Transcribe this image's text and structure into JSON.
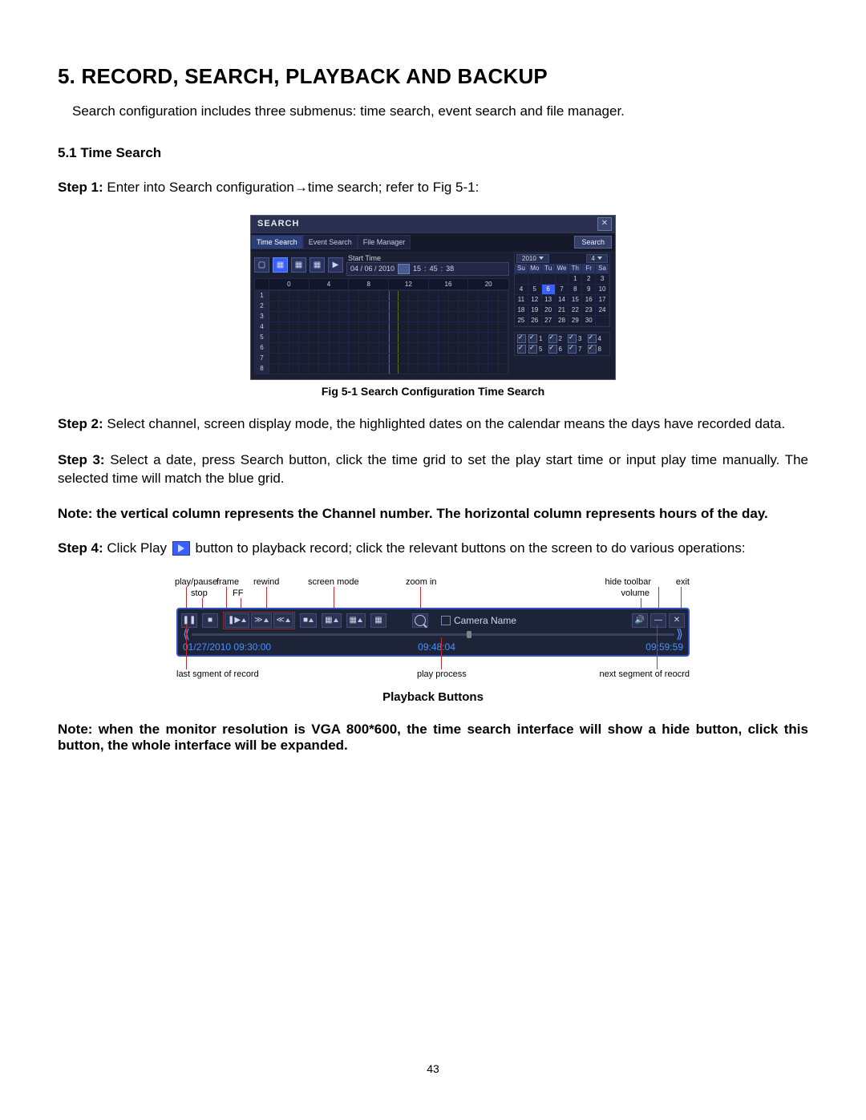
{
  "page_number": "43",
  "chapter_title": "5. RECORD, SEARCH, PLAYBACK AND BACKUP",
  "intro": "Search configuration includes three submenus: time search, event search and file manager.",
  "section_5_1": "5.1 Time Search",
  "step1_prefix": "Step 1: ",
  "step1": "Enter into Search configuration→time search; refer to Fig 5-1:",
  "fig5_1_caption": "Fig 5-1 Search Configuration Time Search",
  "step2_prefix": "Step 2: ",
  "step2": "Select channel, screen display mode, the highlighted dates on the calendar means the days have recorded data.",
  "step3_prefix": "Step 3: ",
  "step3": "Select a date, press Search button, click the time grid to set the play start time or input play time manually. The selected time will match the blue grid.",
  "note1": "Note: the vertical column represents the Channel number. The horizontal column represents hours of the day.",
  "step4_prefix": "Step 4: ",
  "step4_a": "Click Play ",
  "step4_b": " button to playback record; click the relevant buttons on the screen to do various operations:",
  "fig_pb_caption": "Playback Buttons",
  "note2": "Note: when the monitor resolution is VGA 800*600, the time search interface will show a hide button, click this button, the whole interface will be expanded.",
  "search_window": {
    "title": "SEARCH",
    "tabs": [
      "Time Search",
      "Event Search",
      "File Manager"
    ],
    "search_btn": "Search",
    "start_time_label": "Start Time",
    "date_value": "04 / 06 / 2010",
    "time_h": "15",
    "time_m": "45",
    "time_s": "38",
    "hour_headers": [
      "0",
      "4",
      "8",
      "12",
      "16",
      "20"
    ],
    "channels": [
      "1",
      "2",
      "3",
      "4",
      "5",
      "6",
      "7",
      "8"
    ],
    "calendar": {
      "year": "2010",
      "month": "4",
      "dow": [
        "Su",
        "Mo",
        "Tu",
        "We",
        "Th",
        "Fr",
        "Sa"
      ],
      "selected_day": "6",
      "weeks": [
        [
          "",
          "",
          "",
          "",
          "1",
          "2",
          "3"
        ],
        [
          "4",
          "5",
          "6",
          "7",
          "8",
          "9",
          "10"
        ],
        [
          "11",
          "12",
          "13",
          "14",
          "15",
          "16",
          "17"
        ],
        [
          "18",
          "19",
          "20",
          "21",
          "22",
          "23",
          "24"
        ],
        [
          "25",
          "26",
          "27",
          "28",
          "29",
          "30",
          ""
        ]
      ]
    },
    "ch_select": [
      "1",
      "2",
      "3",
      "4",
      "5",
      "6",
      "7",
      "8"
    ]
  },
  "playback": {
    "annotations_top": {
      "play_pause": "play/pause",
      "stop": "stop",
      "frame": "frame",
      "ff": "FF",
      "rewind": "rewind",
      "screen_mode": "screen mode",
      "zoom_in": "zoom in",
      "hide_toolbar": "hide toolbar",
      "volume": "volume",
      "exit": "exit"
    },
    "camera_label": "Camera Name",
    "time_left": "01/27/2010 09:30:00",
    "time_center": "09:48:04",
    "time_right": "09:59:59",
    "annotations_bottom": {
      "last_segment": "last sgment of record",
      "play_process": "play process",
      "next_segment": "next segment of reocrd"
    }
  }
}
